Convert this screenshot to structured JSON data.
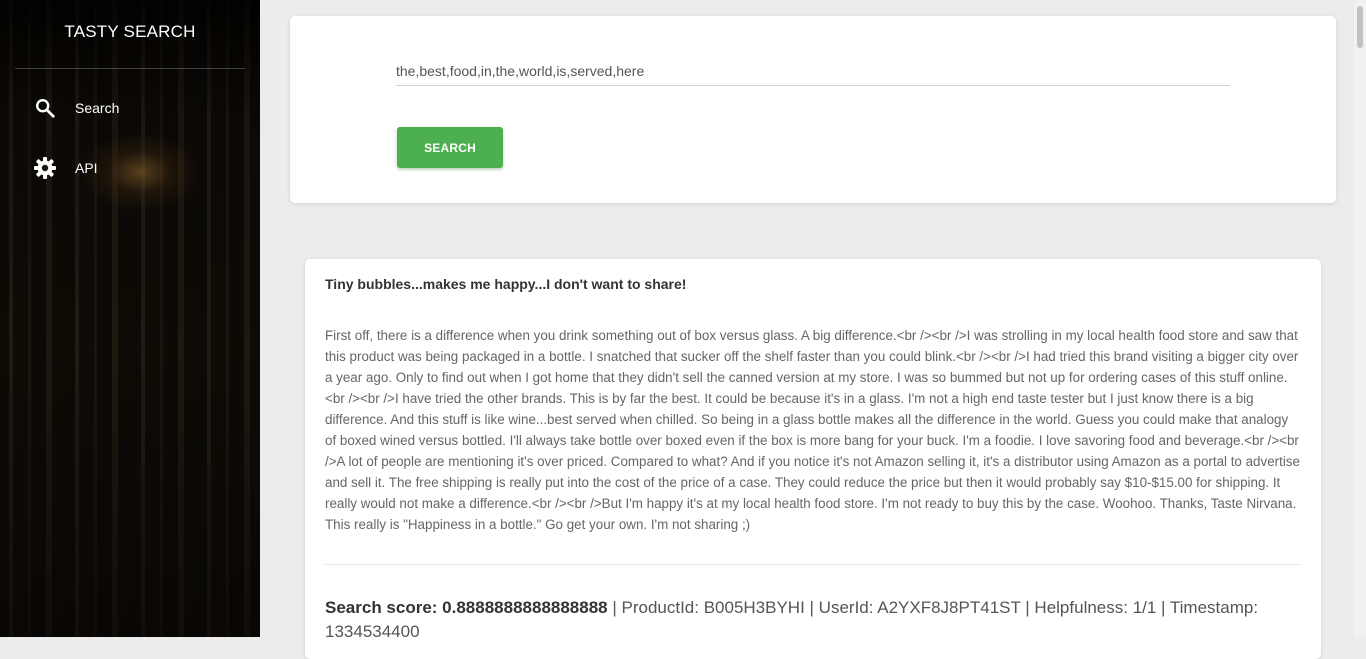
{
  "sidebar": {
    "title": "TASTY SEARCH",
    "items": [
      {
        "label": "Search",
        "icon": "search-icon"
      },
      {
        "label": "API",
        "icon": "gear-icon"
      }
    ]
  },
  "search": {
    "value": "the,best,food,in,the,world,is,served,here",
    "button_label": "SEARCH",
    "button_color": "#4caf50"
  },
  "result": {
    "title": "Tiny bubbles...makes me happy...I don't want to share!",
    "body": "First off, there is a difference when you drink something out of box versus glass. A big difference.<br /><br />I was strolling in my local health food store and saw that this product was being packaged in a bottle. I snatched that sucker off the shelf faster than you could blink.<br /><br />I had tried this brand visiting a bigger city over a year ago. Only to find out when I got home that they didn't sell the canned version at my store. I was so bummed but not up for ordering cases of this stuff online.<br /><br />I have tried the other brands. This is by far the best. It could be because it's in a glass. I'm not a high end taste tester but I just know there is a big difference. And this stuff is like wine...best served when chilled. So being in a glass bottle makes all the difference in the world. Guess you could make that analogy of boxed wined versus bottled. I'll always take bottle over boxed even if the box is more bang for your buck. I'm a foodie. I love savoring food and beverage.<br /><br />A lot of people are mentioning it's over priced. Compared to what? And if you notice it's not Amazon selling it, it's a distributor using Amazon as a portal to advertise and sell it. The free shipping is really put into the cost of the price of a case. They could reduce the price but then it would probably say $10-$15.00 for shipping. It really would not make a difference.<br /><br />But I'm happy it's at my local health food store. I'm not ready to buy this by the case. Woohoo. Thanks, Taste Nirvana. This really is \"Happiness in a bottle.\" Go get your own. I'm not sharing ;)",
    "score_label": "Search score: 0.8888888888888888",
    "meta": " | ProductId: B005H3BYHI | UserId: A2YXF8J8PT41ST | Helpfulness: 1/1 | Timestamp: 1334534400"
  }
}
